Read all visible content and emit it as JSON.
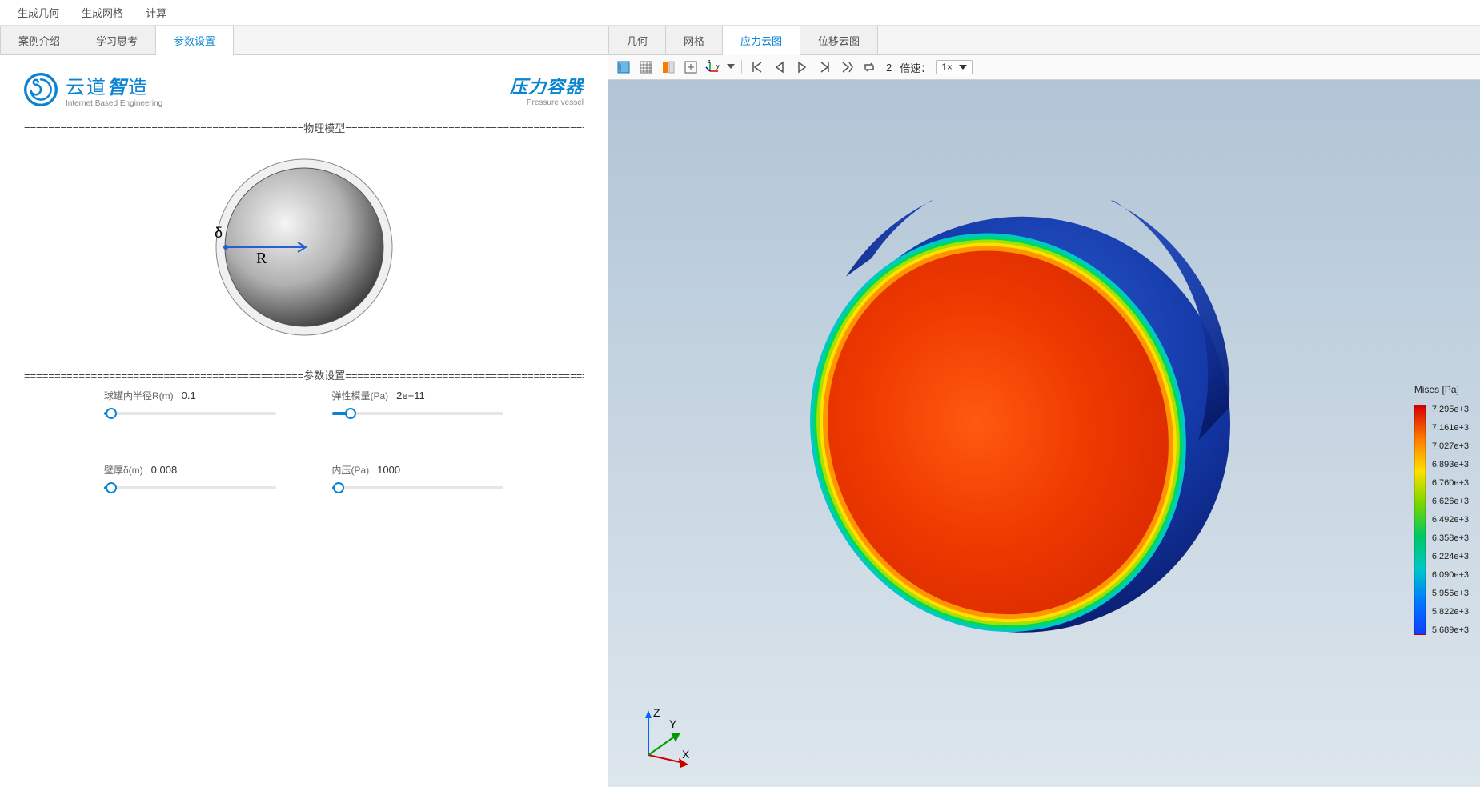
{
  "top_menu": {
    "gen_geom": "生成几何",
    "gen_mesh": "生成网格",
    "compute": "计算"
  },
  "left_tabs": {
    "intro": "案例介绍",
    "study": "学习思考",
    "params": "参数设置"
  },
  "right_tabs": {
    "geom": "几何",
    "mesh": "网格",
    "stress": "应力云图",
    "disp": "位移云图"
  },
  "brand": {
    "cn_prefix": "云道",
    "cn_accent": "智",
    "cn_suffix": "造",
    "en": "Internet Based Engineering",
    "right_cn": "压力容器",
    "right_en": "Pressure vessel"
  },
  "sections": {
    "model_divider": "==============================================物理模型=============================================",
    "params_divider": "==============================================参数设置=============================================",
    "delta_sym": "δ",
    "radius_sym": "R"
  },
  "params": {
    "radius": {
      "label": "球罐内半径R(m)",
      "value": "0.1",
      "pos": 4
    },
    "emodulus": {
      "label": "弹性模量(Pa)",
      "value": "2e+11",
      "pos": 11
    },
    "thickness": {
      "label": "壁厚δ(m)",
      "value": "0.008",
      "pos": 4
    },
    "pressure": {
      "label": "内压(Pa)",
      "value": "1000",
      "pos": 4
    }
  },
  "toolbar": {
    "frame_num": "2",
    "speed_label": "倍速：",
    "speed_value": "1×"
  },
  "legend": {
    "title": "Mises [Pa]",
    "ticks": [
      "7.295e+3",
      "7.161e+3",
      "7.027e+3",
      "6.893e+3",
      "6.760e+3",
      "6.626e+3",
      "6.492e+3",
      "6.358e+3",
      "6.224e+3",
      "6.090e+3",
      "5.956e+3",
      "5.822e+3",
      "5.689e+3"
    ]
  },
  "axis": {
    "x": "X",
    "y": "Y",
    "z": "Z"
  }
}
